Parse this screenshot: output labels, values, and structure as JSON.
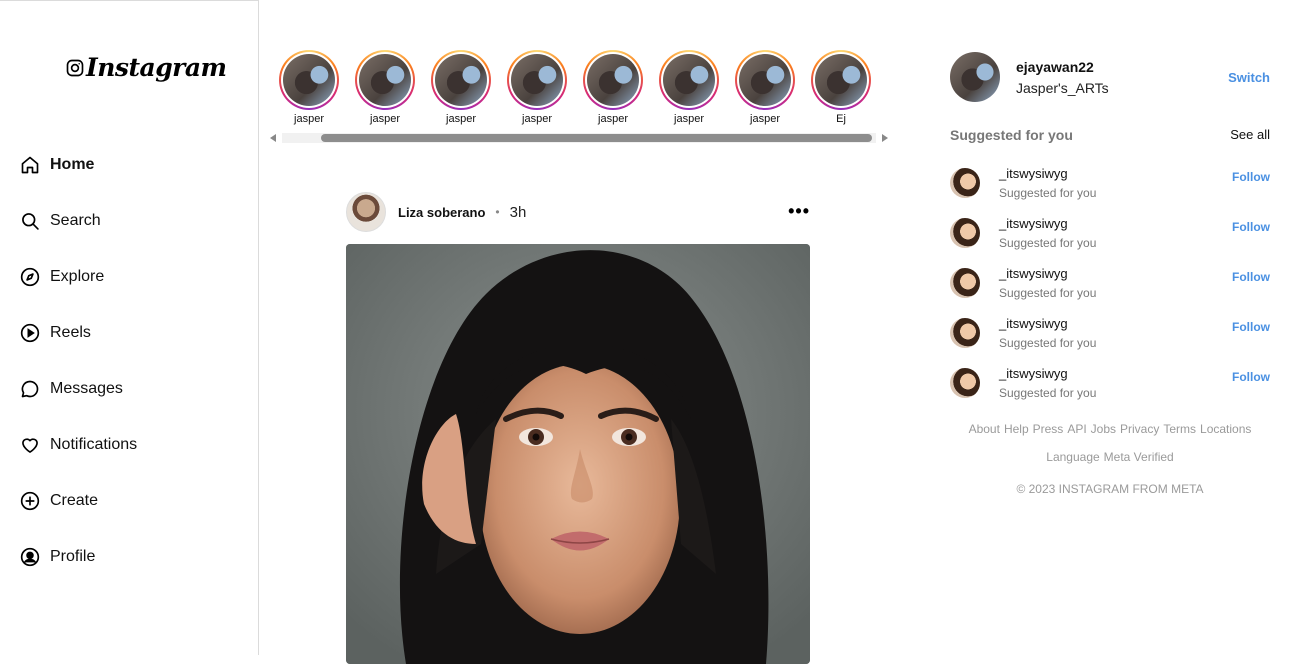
{
  "brand": {
    "logo_text": "Instagram"
  },
  "nav": [
    {
      "label": "Home",
      "icon": "home-icon",
      "active": true
    },
    {
      "label": "Search",
      "icon": "search-icon"
    },
    {
      "label": "Explore",
      "icon": "compass-icon"
    },
    {
      "label": "Reels",
      "icon": "reels-play-icon"
    },
    {
      "label": "Messages",
      "icon": "message-bubble-icon"
    },
    {
      "label": "Notifications",
      "icon": "heart-icon"
    },
    {
      "label": "Create",
      "icon": "plus-circle-icon"
    },
    {
      "label": "Profile",
      "icon": "profile-icon"
    }
  ],
  "stories": [
    {
      "name": "jasper"
    },
    {
      "name": "jasper"
    },
    {
      "name": "jasper"
    },
    {
      "name": "jasper"
    },
    {
      "name": "jasper"
    },
    {
      "name": "jasper"
    },
    {
      "name": "jasper"
    },
    {
      "name": "Ej"
    }
  ],
  "post": {
    "username": "Liza soberano",
    "separator": "•",
    "time": "3h",
    "more": "•••"
  },
  "me": {
    "username": "ejayawan22",
    "name": "Jasper's_ARTs",
    "switch_label": "Switch"
  },
  "suggestions": {
    "title": "Suggested for you",
    "see_all": "See all",
    "items": [
      {
        "username": "_itswysiwyg",
        "subtitle": "Suggested for you",
        "action": "Follow"
      },
      {
        "username": "_itswysiwyg",
        "subtitle": "Suggested for you",
        "action": "Follow"
      },
      {
        "username": "_itswysiwyg",
        "subtitle": "Suggested for you",
        "action": "Follow"
      },
      {
        "username": "_itswysiwyg",
        "subtitle": "Suggested for you",
        "action": "Follow"
      },
      {
        "username": "_itswysiwyg",
        "subtitle": "Suggested for you",
        "action": "Follow"
      }
    ]
  },
  "footer": {
    "links_row1": [
      "About",
      "Help",
      "Press",
      "API",
      "Jobs",
      "Privacy",
      "Terms",
      "Locations"
    ],
    "links_row2": [
      "Language",
      "Meta Verified"
    ],
    "copyright": "© 2023 INSTAGRAM FROM META"
  },
  "colors": {
    "link_blue": "#4a90e2",
    "muted": "#777777",
    "border": "#dbdbdb"
  }
}
